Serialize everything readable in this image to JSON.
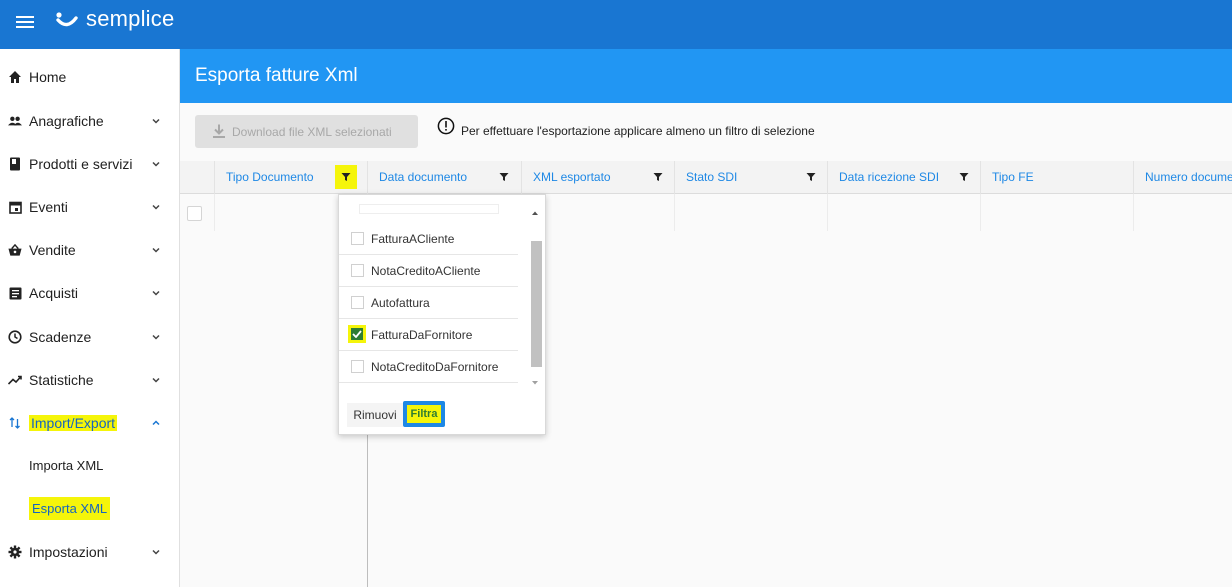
{
  "app": {
    "brand": "semplice"
  },
  "sidebar": {
    "items": [
      {
        "label": "Home",
        "icon": "home-icon"
      },
      {
        "label": "Anagrafiche",
        "icon": "people-icon"
      },
      {
        "label": "Prodotti e servizi",
        "icon": "book-icon"
      },
      {
        "label": "Eventi",
        "icon": "calendar-icon"
      },
      {
        "label": "Vendite",
        "icon": "basket-icon"
      },
      {
        "label": "Acquisti",
        "icon": "list-icon"
      },
      {
        "label": "Scadenze",
        "icon": "clock-icon"
      },
      {
        "label": "Statistiche",
        "icon": "trending-icon"
      },
      {
        "label": "Import/Export",
        "icon": "swap-vertical-icon"
      },
      {
        "label": "Impostazioni",
        "icon": "gear-icon"
      }
    ],
    "sub_items": [
      {
        "label": "Importa XML"
      },
      {
        "label": "Esporta XML"
      }
    ]
  },
  "header": {
    "title": "Esporta fatture Xml"
  },
  "toolbar": {
    "download_label": "Download file XML selezionati",
    "info_text": "Per effettuare l'esportazione applicare almeno un filtro di selezione"
  },
  "grid": {
    "columns": [
      {
        "label": "Tipo Documento"
      },
      {
        "label": "Data documento"
      },
      {
        "label": "XML esportato"
      },
      {
        "label": "Stato SDI"
      },
      {
        "label": "Data ricezione SDI"
      },
      {
        "label": "Tipo FE"
      },
      {
        "label": "Numero docume"
      }
    ]
  },
  "filter_popup": {
    "options": [
      {
        "label": "FatturaACliente",
        "checked": false
      },
      {
        "label": "NotaCreditoACliente",
        "checked": false
      },
      {
        "label": "Autofattura",
        "checked": false
      },
      {
        "label": "FatturaDaFornitore",
        "checked": true
      },
      {
        "label": "NotaCreditoDaFornitore",
        "checked": false
      }
    ],
    "remove_label": "Rimuovi",
    "apply_label": "Filtra"
  },
  "colors": {
    "topbar": "#1976d2",
    "header_band": "#2196f3",
    "highlight": "#f5f50a",
    "accent_text": "#1e88e5",
    "check_green": "#2e7d32"
  }
}
